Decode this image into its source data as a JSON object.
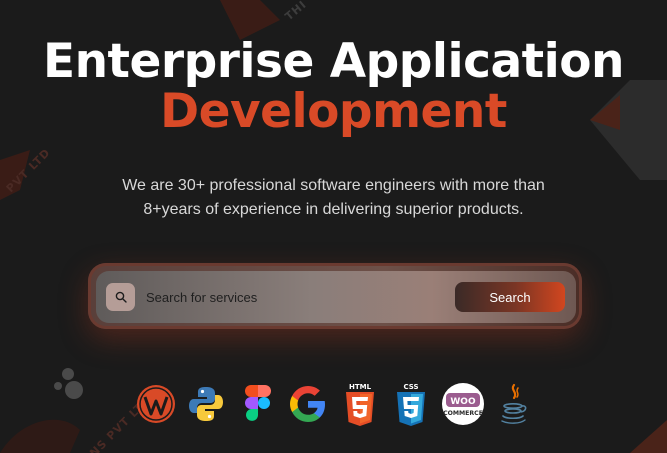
{
  "hero": {
    "title_line1": "Enterprise Application",
    "title_line2": "Development",
    "subtitle_line1": "We are 30+ professional software engineers with more than",
    "subtitle_line2": "8+years of experience in delivering superior products."
  },
  "search": {
    "placeholder": "Search for services",
    "button_label": "Search"
  },
  "watermark": {
    "text_top": "THI",
    "text_left": "PVT LTD",
    "text_bottom": "NS PVT LTD"
  },
  "technologies": [
    {
      "name": "wordpress-icon"
    },
    {
      "name": "python-icon"
    },
    {
      "name": "figma-icon"
    },
    {
      "name": "google-icon"
    },
    {
      "name": "html5-icon",
      "label": "HTML"
    },
    {
      "name": "css3-icon",
      "label": "CSS"
    },
    {
      "name": "woocommerce-icon",
      "label1": "WOO",
      "label2": "COMMERCE"
    },
    {
      "name": "java-icon"
    }
  ],
  "colors": {
    "background": "#1b1b1b",
    "accent": "#d94a27",
    "title": "#ffffff"
  }
}
